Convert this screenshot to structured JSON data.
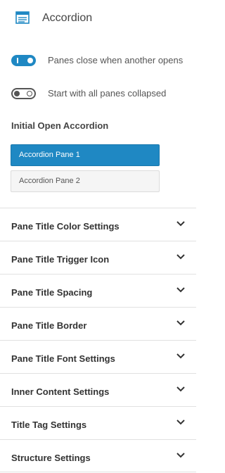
{
  "header": {
    "title": "Accordion",
    "icon": "accordion-block-icon"
  },
  "toggles": [
    {
      "label": "Panes close when another opens",
      "state": "on"
    },
    {
      "label": "Start with all panes collapsed",
      "state": "off"
    }
  ],
  "initial_open": {
    "label": "Initial Open Accordion",
    "panes": [
      {
        "label": "Accordion Pane 1",
        "selected": true
      },
      {
        "label": "Accordion Pane 2",
        "selected": false
      }
    ]
  },
  "settings": [
    {
      "label": "Pane Title Color Settings"
    },
    {
      "label": "Pane Title Trigger Icon"
    },
    {
      "label": "Pane Title Spacing"
    },
    {
      "label": "Pane Title Border"
    },
    {
      "label": "Pane Title Font Settings"
    },
    {
      "label": "Inner Content Settings"
    },
    {
      "label": "Title Tag Settings"
    },
    {
      "label": "Structure Settings"
    }
  ],
  "colors": {
    "accent": "#1f88c3",
    "text": "#333333",
    "divider": "#e1e1e1"
  }
}
